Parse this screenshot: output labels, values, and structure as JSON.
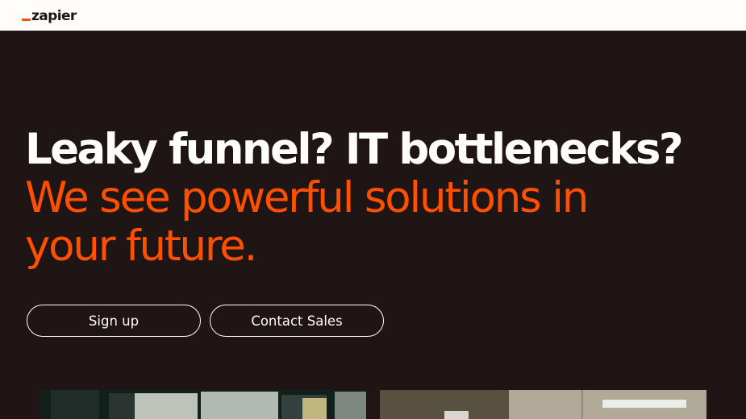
{
  "header": {
    "logo_text": "zapier"
  },
  "hero": {
    "headline_line1": "Leaky funnel? IT bottlenecks?",
    "headline_line2": "We see powerful solutions in",
    "headline_line3": "your future.",
    "signup_label": "Sign up",
    "contact_sales_label": "Contact Sales"
  },
  "colors": {
    "brand_orange": "#ff4f00",
    "dark_background": "#201515",
    "cream": "#fffdf9"
  }
}
